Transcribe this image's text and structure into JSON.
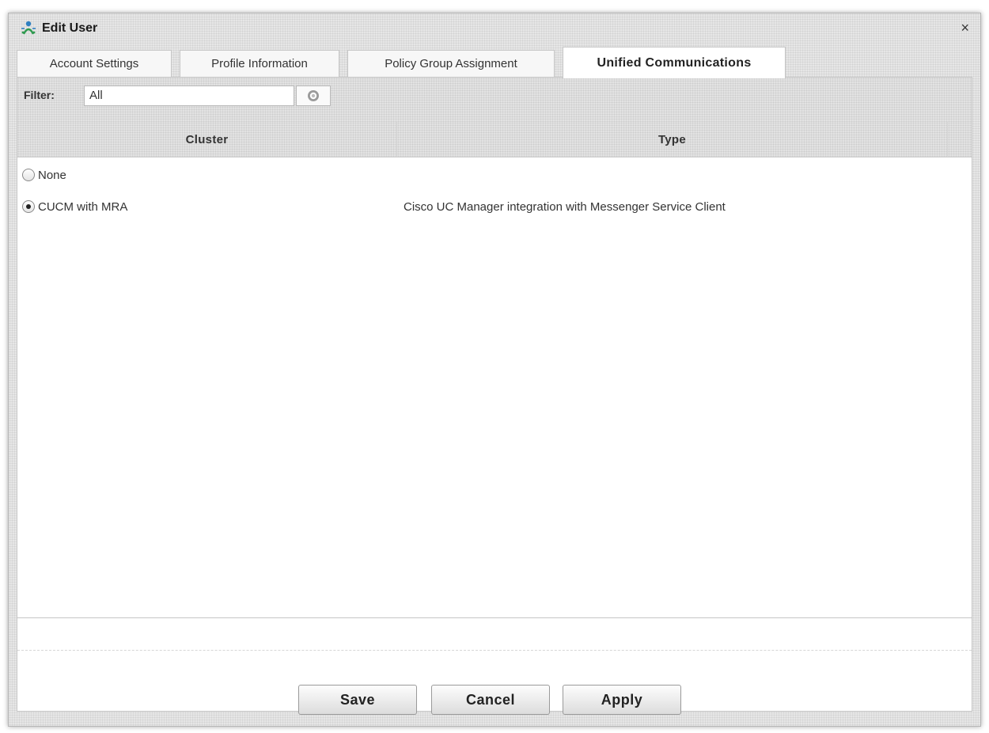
{
  "window": {
    "title": "Edit User",
    "icon": "user-edit-icon",
    "close_glyph": "×"
  },
  "tabs": [
    {
      "label": "Account Settings",
      "active": false
    },
    {
      "label": "Profile Information",
      "active": false
    },
    {
      "label": "Policy Group Assignment",
      "active": false
    },
    {
      "label": "Unified Communications",
      "active": true
    }
  ],
  "filter": {
    "label": "Filter:",
    "value": "All",
    "clear_icon": "clear-circle-icon"
  },
  "grid": {
    "columns": [
      "Cluster",
      "Type"
    ],
    "rows": [
      {
        "cluster": "None",
        "type": "",
        "selected": false
      },
      {
        "cluster": "CUCM with MRA",
        "type": "Cisco UC Manager integration with Messenger Service Client",
        "selected": true
      }
    ]
  },
  "buttons": {
    "save": "Save",
    "cancel": "Cancel",
    "apply": "Apply"
  },
  "colors": {
    "panel_bg": "#e6e6e6",
    "content_bg": "#ffffff",
    "border": "#c6c6c6",
    "text": "#333333"
  }
}
